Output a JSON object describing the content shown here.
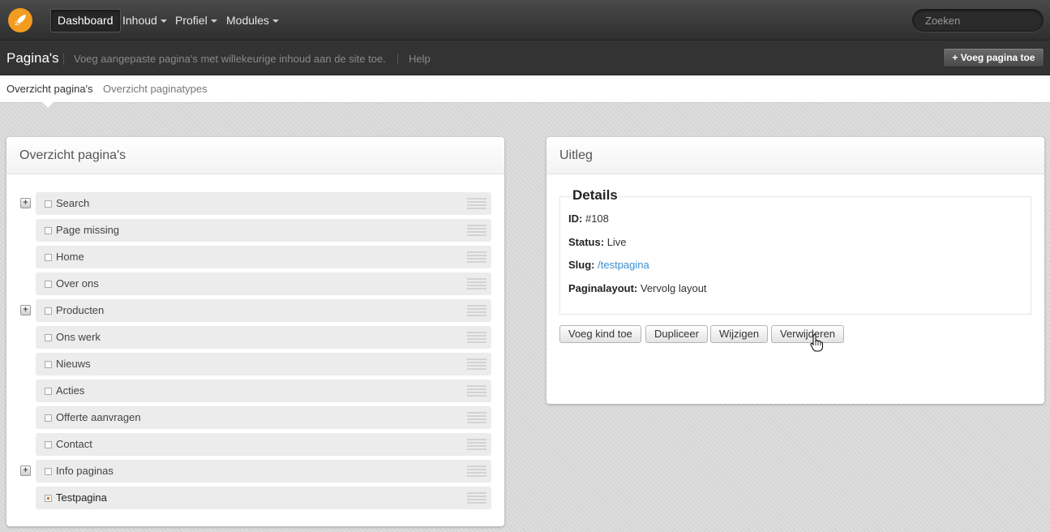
{
  "topbar": {
    "dashboard": "Dashboard",
    "menus": [
      "Inhoud",
      "Profiel",
      "Modules"
    ],
    "search_placeholder": "Zoeken",
    "brand_color": "#f39c1f"
  },
  "subheader": {
    "title": "Pagina's",
    "description": "Voeg aangepaste pagina's met willekeurige inhoud aan de site toe.",
    "help": "Help",
    "add_button": "+ Voeg pagina toe"
  },
  "tabs": {
    "active": "Overzicht pagina's",
    "inactive": "Overzicht paginatypes"
  },
  "left_panel": {
    "title": "Overzicht pagina's",
    "pages": [
      {
        "label": "Search",
        "expandable": true,
        "selected": false
      },
      {
        "label": "Page missing",
        "expandable": false,
        "selected": false
      },
      {
        "label": "Home",
        "expandable": false,
        "selected": false
      },
      {
        "label": "Over ons",
        "expandable": false,
        "selected": false
      },
      {
        "label": "Producten",
        "expandable": true,
        "selected": false
      },
      {
        "label": "Ons werk",
        "expandable": false,
        "selected": false
      },
      {
        "label": "Nieuws",
        "expandable": false,
        "selected": false
      },
      {
        "label": "Acties",
        "expandable": false,
        "selected": false
      },
      {
        "label": "Offerte aanvragen",
        "expandable": false,
        "selected": false
      },
      {
        "label": "Contact",
        "expandable": false,
        "selected": false
      },
      {
        "label": "Info paginas",
        "expandable": true,
        "selected": false
      },
      {
        "label": "Testpagina",
        "expandable": false,
        "selected": true
      }
    ]
  },
  "right_panel": {
    "title": "Uitleg",
    "legend": "Details",
    "id_label": "ID:",
    "id_value": "#108",
    "status_label": "Status:",
    "status_value": "Live",
    "slug_label": "Slug:",
    "slug_value": "/testpagina",
    "layout_label": "Paginalayout:",
    "layout_value": "Vervolg layout",
    "buttons": [
      "Voeg kind toe",
      "Dupliceer",
      "Wijzigen",
      "Verwijderen"
    ]
  }
}
